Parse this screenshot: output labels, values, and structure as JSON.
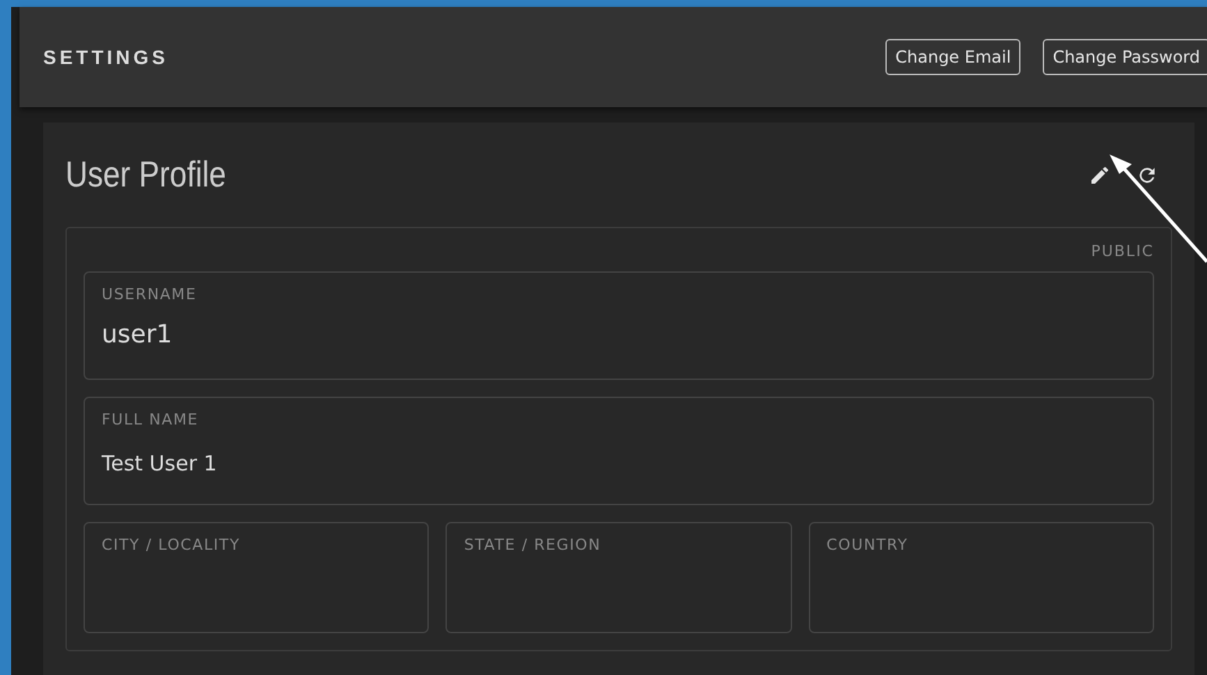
{
  "header": {
    "title": "SETTINGS",
    "buttons": [
      "Change Email",
      "Change Password"
    ]
  },
  "profile": {
    "title": "User Profile",
    "section_label": "PUBLIC",
    "fields": [
      {
        "label": "USERNAME",
        "value": "user1",
        "kind": "large"
      },
      {
        "label": "FULL NAME",
        "value": "Test User 1",
        "kind": "normal"
      }
    ],
    "location_fields": [
      {
        "label": "CITY / LOCALITY"
      },
      {
        "label": "STATE / REGION"
      },
      {
        "label": "COUNTRY"
      }
    ]
  }
}
